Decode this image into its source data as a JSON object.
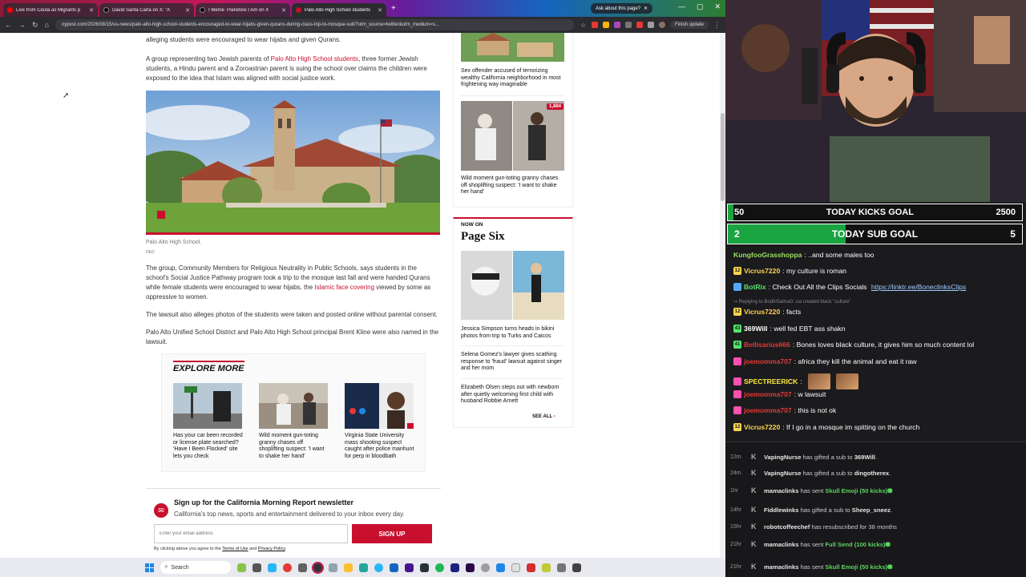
{
  "browser": {
    "tabs": [
      {
        "title": "Live from Ceuta as Migrants p",
        "color": "#ff0000"
      },
      {
        "title": "David Santa Carla on X: \"A",
        "color": "#111111"
      },
      {
        "title": "I Meme Therefore I Am on X",
        "color": "#111111"
      },
      {
        "title": "Palo Alto High School students",
        "color": "#c8102e",
        "active": true
      }
    ],
    "ask_label": "Ask about this page?",
    "url": "nypost.com/2026/08/15/us-news/palo-alto-high-school-students-encouraged-to-wear-hijabs-given-qurans-during-class-trip-to-mosque-suit/?utm_source=twitter&utm_medium=s...",
    "finish_update": "Finish update"
  },
  "article": {
    "p0": "alleging students were encouraged to wear hijabs and given Qurans.",
    "p1_a": "A group representing two Jewish parents of ",
    "p1_link": "Palo Alto High School students",
    "p1_b": ", three former Jewish students, a Hindu parent and a Zoroastrian parent is suing the school over claims the children were exposed to the idea that Islam was aligned with social justice work.",
    "caption": "Palo Alto High School.",
    "credit": "HED",
    "p2_a": "The group, Community Members for Religious Neutrality in Public Schools, says students in the school's Social Justice Pathway program took a trip to the mosque last fall and were handed Qurans while female students were encouraged to wear hijabs, the ",
    "p2_link": "Islamic face covering",
    "p2_b": " viewed by some as oppressive to women.",
    "p3": "The lawsuit also alleges photos of the students were taken and posted online without parental consent.",
    "p4": "Palo Alto Unified School District and Palo Alto High School principal Brent Kline were also named in the lawsuit."
  },
  "explore": {
    "title": "EXPLORE MORE",
    "cards": [
      {
        "text": "Has your car been recorded or license plate searched? 'Have I Been Flocked' site lets you check"
      },
      {
        "text": "Wild moment gun-toting granny chases off shoplifting suspect: 'I want to shake her hand'"
      },
      {
        "text": "Virginia State University mass shooting suspect caught after police manhunt for perp in bloodbath"
      }
    ]
  },
  "newsletter": {
    "title": "Sign up for the California Morning Report newsletter",
    "subtitle": "California's top news, sports and entertainment delivered to your inbox every day.",
    "placeholder": "Enter your email address",
    "button": "SIGN UP",
    "legal_a": "By clicking above you agree to the ",
    "terms": "Terms of Use",
    "legal_and": " and ",
    "privacy": "Privacy Policy",
    "legal_b": "."
  },
  "sidebar": {
    "h1": "Sex offender accused of terrorizing wealthy California neighborhood in most frightening way imaginable",
    "badge": "1,884",
    "h2": "Wild moment gun-toting granny chases off shoplifting suspect: 'I want to shake her hand'",
    "now_on": "NOW ON",
    "page_six": "Page Six",
    "h3": "Jessica Simpson turns heads in bikini photos from trip to Turks and Caicos",
    "h4": "Selena Gomez's lawyer gives scathing response to 'fraud' lawsuit against singer and her mom",
    "h5": "Elizabeth Olsen steps out with newborn after quietly welcoming first child with husband Robbie Arnett",
    "see_all": "SEE ALL"
  },
  "taskbar": {
    "search": "Search"
  },
  "stream": {
    "goal1": {
      "left": "50",
      "label": "TODAY KICKS GOAL",
      "right": "2500",
      "progress": 0.02
    },
    "goal2": {
      "left": "2",
      "label": "TODAY SUB GOAL",
      "right": "5",
      "progress": 0.4
    },
    "chat": [
      {
        "badge": "",
        "badgeColor": "",
        "nick": "KungfooGrasshoppa",
        "nickColor": "#9be15d",
        "text": ": ..and some males too"
      },
      {
        "badge": "12",
        "badgeColor": "#ffd54f",
        "nick": "Vicrus7220",
        "nickColor": "#ffd54f",
        "text": ": my culture is roman"
      },
      {
        "badge": "",
        "badgeColor": "#53a6ff",
        "nick": "BotRix",
        "nickColor": "#53e66a",
        "text": ": Check Out All the Clips Socials ",
        "link": "https://linktr.ee/BoneclinksClips"
      },
      {
        "reply": "Replying to BodhiSattva0: cia created black \"culture\""
      },
      {
        "badge": "12",
        "badgeColor": "#ffd54f",
        "nick": "Vicrus7220",
        "nickColor": "#ffd54f",
        "text": ": facts"
      },
      {
        "badge": "43",
        "badgeColor": "#53e66a",
        "nick": "369Will",
        "nickColor": "#ffffff",
        "text": ": well fed EBT ass shakn"
      },
      {
        "badge": "41",
        "badgeColor": "#53e66a",
        "nick": "Bellisarius666",
        "nickColor": "#e53935",
        "text": ": Bones loves black culture, it gives him so much content lol"
      },
      {
        "badge": "",
        "badgeColor": "#ff4fb0",
        "nick": "joemomma707",
        "nickColor": "#e53935",
        "text": ": africa they kill the animal and eat it raw"
      },
      {
        "badge": "",
        "badgeColor": "#ff4fb0",
        "nick": "SPECTREERICK",
        "nickColor": "#ffeb3b",
        "text": ":",
        "emotes": 2
      },
      {
        "badge": "",
        "badgeColor": "#ff4fb0",
        "nick": "joemomma707",
        "nickColor": "#e53935",
        "text": ": w lawsuit"
      },
      {
        "badge": "",
        "badgeColor": "#ff4fb0",
        "nick": "joemomma707",
        "nickColor": "#e53935",
        "text": ": this is not ok"
      },
      {
        "badge": "12",
        "badgeColor": "#ffd54f",
        "nick": "Vicrus7220",
        "nickColor": "#ffd54f",
        "text": ": If I go in a mosque im spitting on the church"
      }
    ],
    "events": [
      {
        "time": "12m",
        "user": "VapingNurse",
        "mid": " has gifted a sub to ",
        "target": "369Will",
        "end": "."
      },
      {
        "time": "24m",
        "user": "VapingNurse",
        "mid": " has gifted a sub to ",
        "target": "dingotherex",
        "end": "."
      },
      {
        "time": "1hr",
        "user": "mamaclinks",
        "mid": " has sent ",
        "green": "Skull Emoji (50 kicks)",
        "end": ""
      },
      {
        "time": "14hr",
        "user": "Fiddlewinks",
        "mid": " has gifted a sub to ",
        "target": "Sheep_sneez",
        "end": "."
      },
      {
        "time": "15hr",
        "user": "robotcoffeechef",
        "mid": " has resubscribed for 38 months",
        "end": ""
      },
      {
        "time": "21hr",
        "user": "mamaclinks",
        "mid": " has sent ",
        "green": "Full Send (100 kicks)",
        "end": ""
      },
      {
        "time": "21hr",
        "user": "mamaclinks",
        "mid": " has sent ",
        "green": "Skull Emoji (50 kicks)",
        "end": ""
      }
    ]
  }
}
